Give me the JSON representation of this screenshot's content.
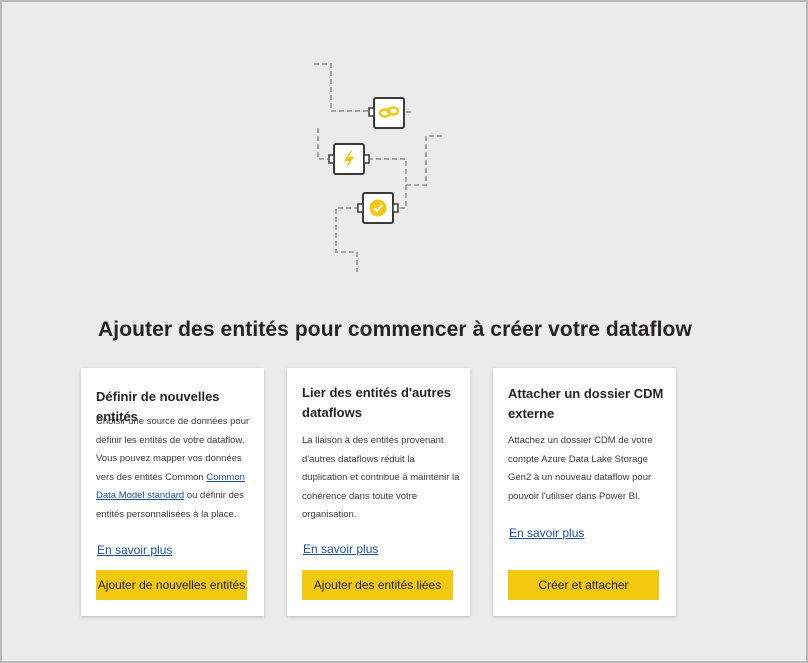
{
  "page": {
    "heading": "Ajouter des entités pour commencer à créer votre dataflow"
  },
  "illustration": {
    "icons": [
      "link-icon",
      "lightning-icon",
      "badge-check-icon"
    ],
    "accent": "#f2c811"
  },
  "cards": [
    {
      "title": "Définir de nouvelles entités",
      "desc_before": "Choisir une source de données pour définir les entités de votre dataflow. Vous pouvez mapper vos données vers des entités Common ",
      "desc_link": "Common Data Model standard",
      "desc_after": " ou définir des entités personnalisées à la place.",
      "learn_more": "En savoir plus",
      "button": "Ajouter de nouvelles entités"
    },
    {
      "title": "Lier des entités d'autres dataflows",
      "desc": "La liaison à des entités provenant d'autres dataflows réduit la duplication et contribue à maintenir la cohérence dans toute votre organisation.",
      "learn_more": "En savoir plus",
      "button": "Ajouter des entités liées"
    },
    {
      "title": "Attacher un dossier CDM externe",
      "desc": "Attachez un dossier CDM de votre compte Azure Data Lake Storage Gen2 à un nouveau dataflow pour pouvoir l'utiliser dans Power BI.",
      "learn_more": "En savoir plus",
      "button": "Créer et attacher"
    }
  ],
  "colors": {
    "background": "#ebebeb",
    "card": "#ffffff",
    "button": "#f2c811",
    "link": "#1b4fa8",
    "text": "#252423"
  }
}
